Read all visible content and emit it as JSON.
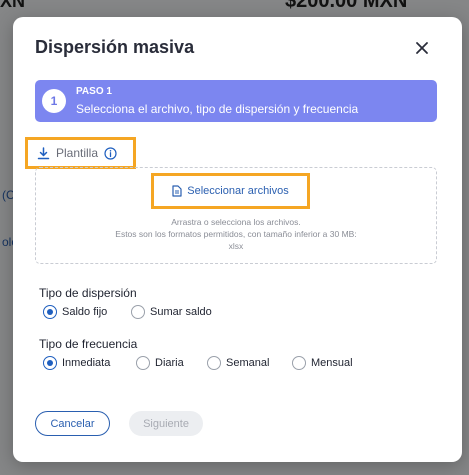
{
  "background": {
    "top_left_fragment": "XN",
    "amount_fragment": "$200.00 MXN",
    "link_fragment_1": "(C",
    "link_fragment_2": "olo"
  },
  "modal": {
    "title": "Dispersión masiva",
    "close_icon": "close-icon"
  },
  "step": {
    "number": "1",
    "label": "PASO 1",
    "description": "Selecciona el archivo, tipo de dispersión y frecuencia"
  },
  "template": {
    "label": "Plantilla",
    "icon": "download-icon",
    "info_icon": "info-icon"
  },
  "upload": {
    "button_label": "Seleccionar archivos",
    "button_icon": "file-icon",
    "hint_line1": "Arrastra o selecciona los archivos.",
    "hint_line2": "Estos son los formatos permitidos, con tamaño inferior a 30 MB:",
    "hint_line3": "xlsx"
  },
  "dispersion_type": {
    "label": "Tipo de dispersión",
    "options": [
      "Saldo fijo",
      "Sumar saldo"
    ],
    "selected": "Saldo fijo"
  },
  "frequency": {
    "label": "Tipo de frecuencia",
    "options": [
      "Inmediata",
      "Diaria",
      "Semanal",
      "Mensual"
    ],
    "selected": "Inmediata"
  },
  "actions": {
    "cancel_label": "Cancelar",
    "next_label": "Siguiente"
  },
  "colors": {
    "step_banner": "#7c86f0",
    "highlight_border": "#f5a623",
    "primary_blue": "#2a5fb0"
  }
}
